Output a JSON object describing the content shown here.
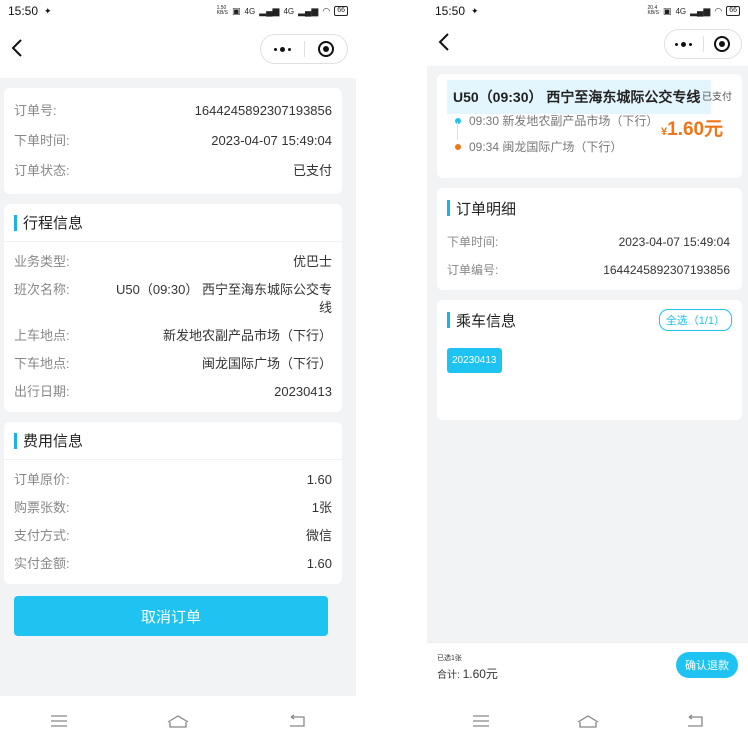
{
  "status_bar": {
    "time": "15:50",
    "left_speed": "1.50\nKB/S",
    "right_speed": "20.4\nKB/S",
    "network": "4G",
    "battery": "66"
  },
  "left": {
    "order_card": [
      {
        "label": "订单号:",
        "value": "1644245892307193856"
      },
      {
        "label": "下单时间:",
        "value": "2023-04-07 15:49:04"
      },
      {
        "label": "订单状态:",
        "value": "已支付"
      }
    ],
    "trip_section": {
      "title": "行程信息",
      "rows": [
        {
          "label": "业务类型:",
          "value": "优巴士"
        },
        {
          "label": "班次名称:",
          "value": "U50（09:30） 西宁至海东城际公交专线"
        },
        {
          "label": "上车地点:",
          "value": "新发地农副产品市场（下行）"
        },
        {
          "label": "下车地点:",
          "value": "闽龙国际广场（下行）"
        },
        {
          "label": "出行日期:",
          "value": "20230413"
        }
      ]
    },
    "fee_section": {
      "title": "费用信息",
      "rows": [
        {
          "label": "订单原价:",
          "value": "1.60"
        },
        {
          "label": "购票张数:",
          "value": "1张"
        },
        {
          "label": "支付方式:",
          "value": "微信"
        },
        {
          "label": "实付金额:",
          "value": "1.60"
        }
      ]
    },
    "cancel_label": "取消订单"
  },
  "right": {
    "route": {
      "title": "U50（09:30） 西宁至海东城际公交专线",
      "status": "已支付",
      "board_stop": "09:30  新发地农副产品市场（下行）",
      "alight_stop": "09:34  闽龙国际广场（下行）",
      "price_symbol": "¥",
      "price": "1.60元",
      "board_color": "#1fc3f1",
      "alight_color": "#f17417"
    },
    "detail_section": {
      "title": "订单明细",
      "rows": [
        {
          "label": "下单时间:",
          "value": "2023-04-07 15:49:04"
        },
        {
          "label": "订单编号:",
          "value": "1644245892307193856"
        }
      ]
    },
    "rider_section": {
      "title": "乘车信息",
      "select_all": "全选（1/1）",
      "date_chip": "20230413"
    },
    "footer": {
      "selected": "已选1张",
      "total_label": "合计:",
      "total_value": "1.60元",
      "refund_label": "确认退款"
    }
  },
  "colors": {
    "accent": "#1fc3f1",
    "price": "#f17417",
    "background": "#f2f3f5"
  }
}
